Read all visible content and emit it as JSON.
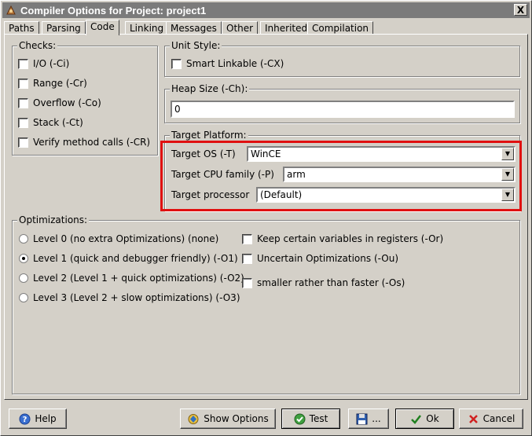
{
  "window": {
    "title": "Compiler Options for Project: project1",
    "close_glyph": "X"
  },
  "tabs": [
    {
      "label": "Paths"
    },
    {
      "label": "Parsing"
    },
    {
      "label": "Code",
      "active": true
    },
    {
      "label": "Linking"
    },
    {
      "label": "Messages"
    },
    {
      "label": "Other"
    },
    {
      "label": "Inherited"
    },
    {
      "label": "Compilation"
    }
  ],
  "checks": {
    "legend": "Checks:",
    "items": [
      {
        "label": "I/O (-Ci)",
        "checked": false
      },
      {
        "label": "Range (-Cr)",
        "checked": false
      },
      {
        "label": "Overflow (-Co)",
        "checked": false
      },
      {
        "label": "Stack (-Ct)",
        "checked": false
      },
      {
        "label": "Verify method calls (-CR)",
        "checked": false
      }
    ]
  },
  "unit_style": {
    "legend": "Unit Style:",
    "smart_linkable": {
      "label": "Smart Linkable (-CX)",
      "checked": false
    }
  },
  "heap_size": {
    "legend": "Heap Size (-Ch):",
    "value": "0"
  },
  "target_platform": {
    "legend": "Target Platform:",
    "os": {
      "label": "Target OS (-T)",
      "value": "WinCE"
    },
    "cpu": {
      "label": "Target CPU family (-P)",
      "value": "arm"
    },
    "processor": {
      "label": "Target processor",
      "value": "(Default)"
    }
  },
  "optimizations": {
    "legend": "Optimizations:",
    "levels": [
      {
        "label": "Level 0 (no extra Optimizations) (none)",
        "selected": false
      },
      {
        "label": "Level 1 (quick and debugger friendly) (-O1)",
        "selected": true
      },
      {
        "label": "Level 2 (Level 1 + quick optimizations) (-O2)",
        "selected": false
      },
      {
        "label": "Level 3 (Level 2 + slow optimizations) (-O3)",
        "selected": false
      }
    ],
    "options": [
      {
        "label": "Keep certain variables in registers (-Or)",
        "checked": false
      },
      {
        "label": "Uncertain Optimizations (-Ou)",
        "checked": false
      },
      {
        "label": "smaller rather than faster (-Os)",
        "checked": false
      }
    ]
  },
  "buttons": {
    "help": "Help",
    "show_options": "Show Options",
    "test": "Test",
    "save": "...",
    "ok": "Ok",
    "cancel": "Cancel"
  },
  "colors": {
    "highlight": "#e01010",
    "titlebar": "#7b7b7b",
    "face": "#d4d0c8"
  }
}
